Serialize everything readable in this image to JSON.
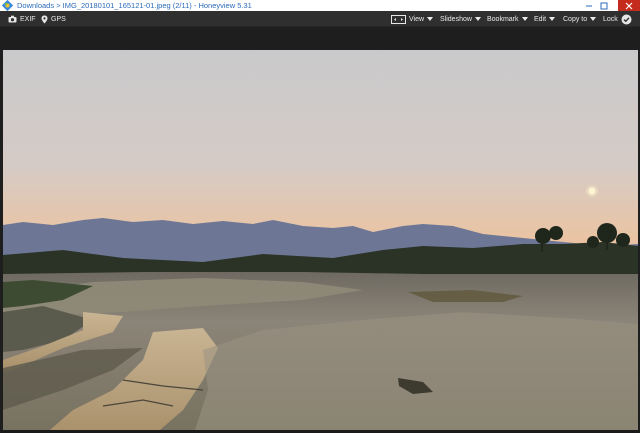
{
  "window": {
    "title": "Downloads > IMG_20180101_165121-01.jpeg (2/11) - Honeyview 5.31"
  },
  "toolbar": {
    "exif_label": "EXIF",
    "gps_label": "GPS",
    "view_label": "View",
    "slideshow_label": "Slideshow",
    "bookmark_label": "Bookmark",
    "edit_label": "Edit",
    "copy_to_label": "Copy to",
    "lock_label": "Lock"
  },
  "icons": {
    "app": "honeyview-logo-icon",
    "minimize": "minimize-icon",
    "maximize": "maximize-icon",
    "close": "close-icon",
    "exif": "camera-icon",
    "gps": "location-pin-icon",
    "view": "fit-screen-icon",
    "lock": "lock-check-icon"
  },
  "colors": {
    "titlebar_text": "#2b6bb8",
    "toolbar_bg": "#2f2f2f",
    "viewer_bg": "#1e1e1e"
  }
}
